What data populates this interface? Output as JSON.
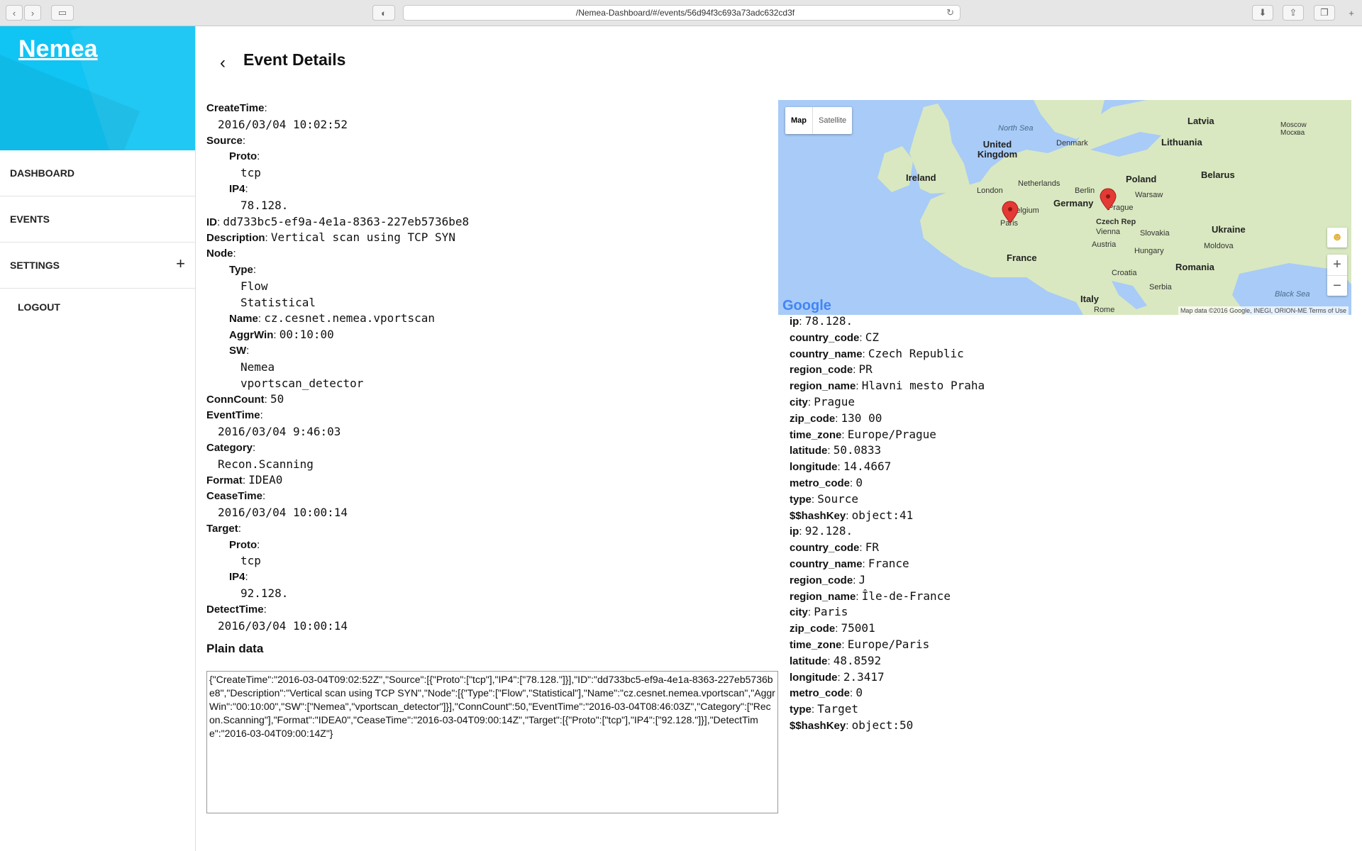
{
  "browser": {
    "url": "   /Nemea-Dashboard/#/events/56d94f3c693a73adc632cd3f"
  },
  "sidebar": {
    "brand": "Nemea",
    "items": [
      {
        "label": "DASHBOARD"
      },
      {
        "label": "EVENTS"
      },
      {
        "label": "SETTINGS"
      },
      {
        "label": "LOGOUT"
      }
    ],
    "expand_glyph": "+"
  },
  "page": {
    "back_glyph": "‹",
    "title": "Event Details"
  },
  "event": {
    "create_time_label": "CreateTime",
    "create_time": "2016/03/04 10:02:52",
    "source_label": "Source",
    "source_proto_label": "Proto",
    "source_proto": "tcp",
    "source_ip4_label": "IP4",
    "source_ip4": "78.128.",
    "id_label": "ID",
    "id": "dd733bc5-ef9a-4e1a-8363-227eb5736be8",
    "description_label": "Description",
    "description": "Vertical scan using TCP SYN",
    "node_label": "Node",
    "node_type_label": "Type",
    "node_type_1": "Flow",
    "node_type_2": "Statistical",
    "node_name_label": "Name",
    "node_name": "cz.cesnet.nemea.vportscan",
    "node_aggrwin_label": "AggrWin",
    "node_aggrwin": "00:10:00",
    "node_sw_label": "SW",
    "node_sw_1": "Nemea",
    "node_sw_2": "vportscan_detector",
    "conncount_label": "ConnCount",
    "conncount": "50",
    "event_time_label": "EventTime",
    "event_time": "2016/03/04 9:46:03",
    "category_label": "Category",
    "category": "Recon.Scanning",
    "format_label": "Format",
    "format": "IDEA0",
    "cease_time_label": "CeaseTime",
    "cease_time": "2016/03/04 10:00:14",
    "target_label": "Target",
    "target_proto_label": "Proto",
    "target_proto": "tcp",
    "target_ip4_label": "IP4",
    "target_ip4": "92.128.",
    "detect_time_label": "DetectTime",
    "detect_time": "2016/03/04 10:00:14"
  },
  "plain": {
    "title": "Plain data",
    "text": "{\"CreateTime\":\"2016-03-04T09:02:52Z\",\"Source\":[{\"Proto\":[\"tcp\"],\"IP4\":[\"78.128.\"]}],\"ID\":\"dd733bc5-ef9a-4e1a-8363-227eb5736be8\",\"Description\":\"Vertical scan using TCP SYN\",\"Node\":[{\"Type\":[\"Flow\",\"Statistical\"],\"Name\":\"cz.cesnet.nemea.vportscan\",\"AggrWin\":\"00:10:00\",\"SW\":[\"Nemea\",\"vportscan_detector\"]}],\"ConnCount\":50,\"EventTime\":\"2016-03-04T08:46:03Z\",\"Category\":[\"Recon.Scanning\"],\"Format\":\"IDEA0\",\"CeaseTime\":\"2016-03-04T09:00:14Z\",\"Target\":[{\"Proto\":[\"tcp\"],\"IP4\":[\"92.128.\"]}],\"DetectTime\":\"2016-03-04T09:00:14Z\"}"
  },
  "map": {
    "toggle_map": "Map",
    "toggle_satellite": "Satellite",
    "zoom_in": "+",
    "zoom_out": "−",
    "logo": "Google",
    "attribution": "Map data ©2016 Google, INEGI, ORION-ME   Terms of Use",
    "labels": {
      "north_sea": "North Sea",
      "united_kingdom": "United Kingdom",
      "ireland": "Ireland",
      "london": "London",
      "netherlands": "Netherlands",
      "belgium": "Belgium",
      "france": "France",
      "paris": "Paris",
      "denmark": "Denmark",
      "germany": "Germany",
      "berlin": "Berlin",
      "poland": "Poland",
      "warsaw": "Warsaw",
      "prague": "Prague",
      "czech_rep": "Czech Rep",
      "vienna": "Vienna",
      "slovakia": "Slovakia",
      "austria": "Austria",
      "hungary": "Hungary",
      "croatia": "Croatia",
      "serbia": "Serbia",
      "romania": "Romania",
      "italy": "Italy",
      "rome": "Rome",
      "ukraine": "Ukraine",
      "moldova": "Moldova",
      "belarus": "Belarus",
      "lithuania": "Lithuania",
      "latvia": "Latvia",
      "moscow": "Moscow\nМосква",
      "black_sea": "Black Sea"
    }
  },
  "geo": {
    "source": {
      "ip_label": "ip",
      "ip": "78.128.",
      "country_code_label": "country_code",
      "country_code": "CZ",
      "country_name_label": "country_name",
      "country_name": "Czech Republic",
      "region_code_label": "region_code",
      "region_code": "PR",
      "region_name_label": "region_name",
      "region_name": "Hlavni mesto Praha",
      "city_label": "city",
      "city": "Prague",
      "zip_code_label": "zip_code",
      "zip_code": "130 00",
      "time_zone_label": "time_zone",
      "time_zone": "Europe/Prague",
      "latitude_label": "latitude",
      "latitude": "50.0833",
      "longitude_label": "longitude",
      "longitude": "14.4667",
      "metro_code_label": "metro_code",
      "metro_code": "0",
      "type_label": "type",
      "type": "Source",
      "hashkey_label": "$$hashKey",
      "hashkey": "object:41"
    },
    "target": {
      "ip_label": "ip",
      "ip": "92.128.",
      "country_code_label": "country_code",
      "country_code": "FR",
      "country_name_label": "country_name",
      "country_name": "France",
      "region_code_label": "region_code",
      "region_code": "J",
      "region_name_label": "region_name",
      "region_name": "Île-de-France",
      "city_label": "city",
      "city": "Paris",
      "zip_code_label": "zip_code",
      "zip_code": "75001",
      "time_zone_label": "time_zone",
      "time_zone": "Europe/Paris",
      "latitude_label": "latitude",
      "latitude": "48.8592",
      "longitude_label": "longitude",
      "longitude": "2.3417",
      "metro_code_label": "metro_code",
      "metro_code": "0",
      "type_label": "type",
      "type": "Target",
      "hashkey_label": "$$hashKey",
      "hashkey": "object:50"
    }
  },
  "colors": {
    "brand": "#10c4f4",
    "marker": "#e53935",
    "water": "#a8cbf7",
    "land": "#d9e8c0"
  }
}
